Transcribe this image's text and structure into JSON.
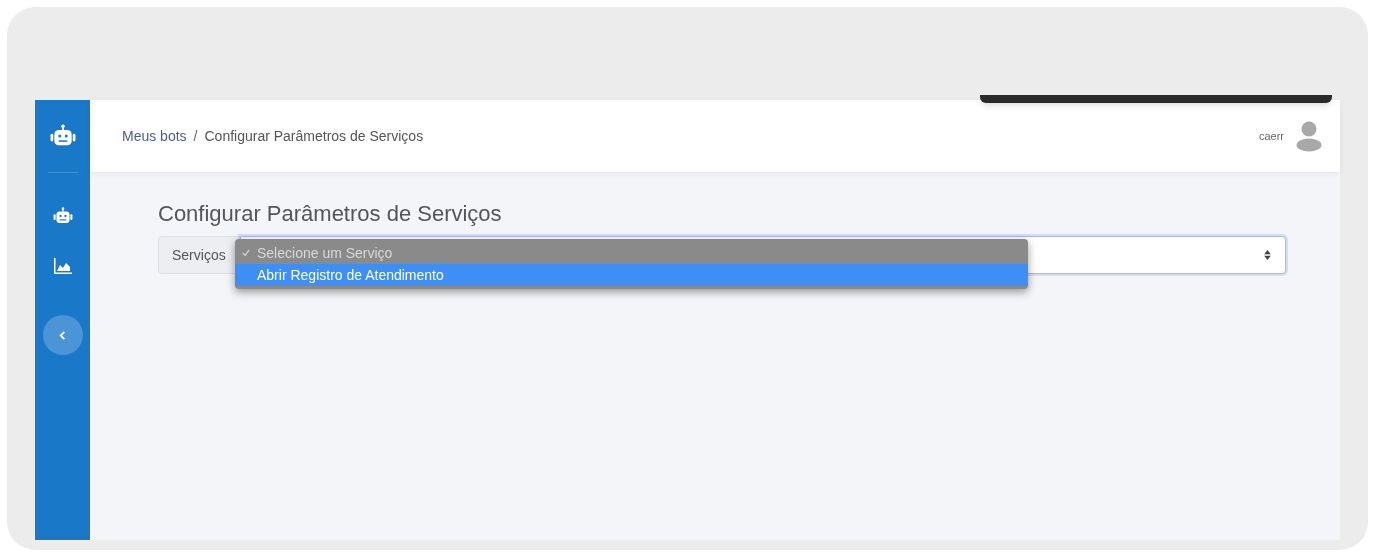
{
  "breadcrumb_separator": "/",
  "breadcrumb": [
    {
      "label": "Meus bots",
      "link": true
    },
    {
      "label": "Configurar Parâmetros de Serviços",
      "link": false
    }
  ],
  "user": {
    "name": "caerr"
  },
  "page_title": "Configurar Parâmetros de Serviços",
  "service_field": {
    "label": "Serviços",
    "open": true,
    "options": [
      {
        "label": "Selecione um Serviço",
        "checked": true,
        "highlighted": false
      },
      {
        "label": "Abrir Registro de Atendimento",
        "checked": false,
        "highlighted": true
      }
    ]
  }
}
